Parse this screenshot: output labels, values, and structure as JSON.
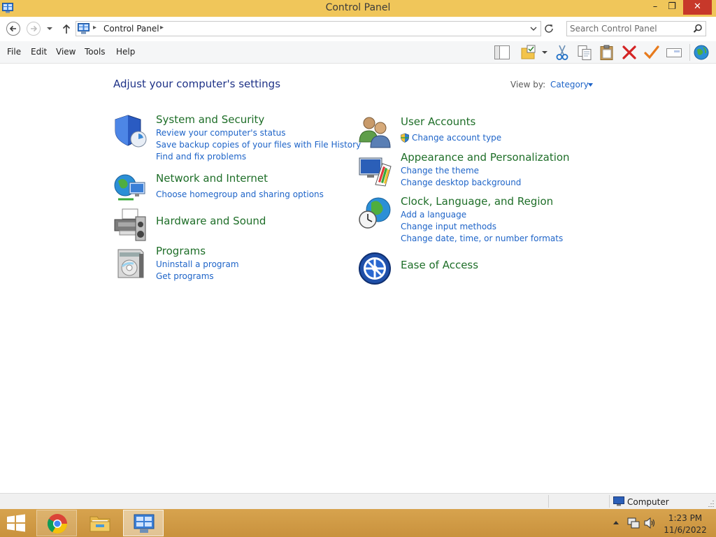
{
  "window": {
    "title": "Control Panel",
    "minimize_label": "–",
    "maximize_label": "❐",
    "close_label": "✕"
  },
  "address": {
    "sep1": "▸",
    "crumb": "Control Panel",
    "sep2": "▸"
  },
  "search": {
    "placeholder": "Search Control Panel"
  },
  "menu": {
    "file": "File",
    "edit": "Edit",
    "view": "View",
    "tools": "Tools",
    "help": "Help"
  },
  "content": {
    "heading": "Adjust your computer's settings",
    "view_by_label": "View by:",
    "view_by_value": "Category"
  },
  "categories": {
    "system": {
      "title": "System and Security",
      "icon": "shield-icon",
      "links": [
        "Review your computer's status",
        "Save backup copies of your files with File History",
        "Find and fix problems"
      ]
    },
    "network": {
      "title": "Network and Internet",
      "icon": "network-globe-icon",
      "links": [
        "Choose homegroup and sharing options"
      ]
    },
    "hardware": {
      "title": "Hardware and Sound",
      "icon": "printer-icon",
      "links": []
    },
    "programs": {
      "title": "Programs",
      "icon": "programs-box-icon",
      "links": [
        "Uninstall a program",
        "Get programs"
      ]
    },
    "users": {
      "title": "User Accounts",
      "icon": "users-icon",
      "links": [
        "Change account type"
      ]
    },
    "appearance": {
      "title": "Appearance and Personalization",
      "icon": "monitor-palette-icon",
      "links": [
        "Change the theme",
        "Change desktop background"
      ]
    },
    "clock": {
      "title": "Clock, Language, and Region",
      "icon": "clock-globe-icon",
      "links": [
        "Add a language",
        "Change input methods",
        "Change date, time, or number formats"
      ]
    },
    "ease": {
      "title": "Ease of Access",
      "icon": "ease-of-access-icon",
      "links": []
    }
  },
  "statusbar": {
    "location": "Computer"
  },
  "taskbar": {
    "time": "1:23 PM",
    "date": "11/6/2022"
  },
  "colors": {
    "titlebar": "#f0c65a",
    "heading": "#1e3287",
    "category_title": "#1e6e28",
    "link": "#1e64c8",
    "close_button": "#c7382a",
    "taskbar": "#d7a34e"
  }
}
